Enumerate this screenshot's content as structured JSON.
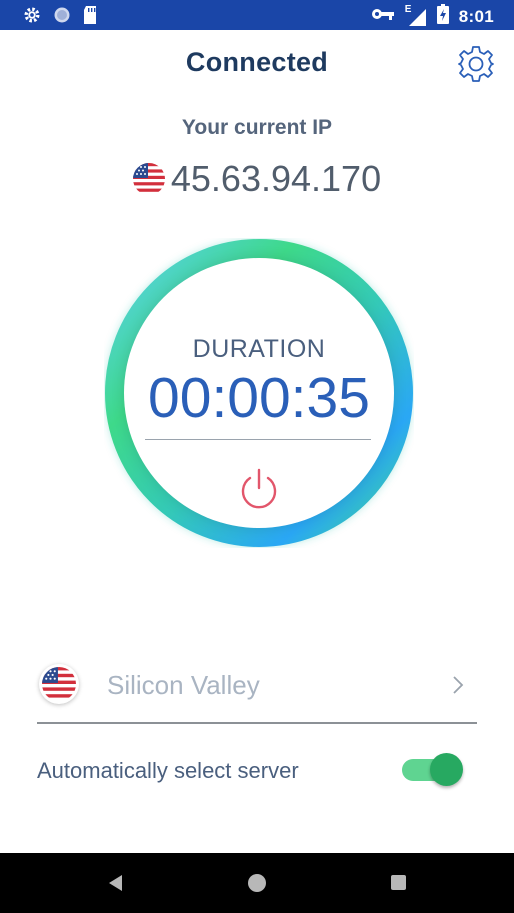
{
  "status_bar": {
    "time": "8:01",
    "network_type": "E",
    "icons": [
      "settings-gear-icon",
      "sync-circle-icon",
      "sd-card-icon",
      "vpn-key-icon",
      "signal-icon",
      "battery-charging-icon"
    ]
  },
  "header": {
    "title": "Connected",
    "settings_icon": "gear-icon"
  },
  "ip_section": {
    "label": "Your current IP",
    "ip": "45.63.94.170",
    "flag": "us-flag-icon"
  },
  "timer": {
    "label": "DURATION",
    "value": "00:00:35",
    "power_icon": "power-icon",
    "colors": {
      "ring_green": "#3ed98a",
      "ring_blue": "#2aa7f5",
      "power_red": "#e2566b"
    }
  },
  "server": {
    "name": "Silicon Valley",
    "flag": "us-flag-icon",
    "chevron": "chevron-right-icon"
  },
  "auto_select": {
    "label": "Automatically select server",
    "enabled": true
  },
  "colors": {
    "status_bar": "#1a46a8",
    "title": "#1e3a5f",
    "accent_blue": "#2a5fb8",
    "toggle_on": "#27a961"
  }
}
